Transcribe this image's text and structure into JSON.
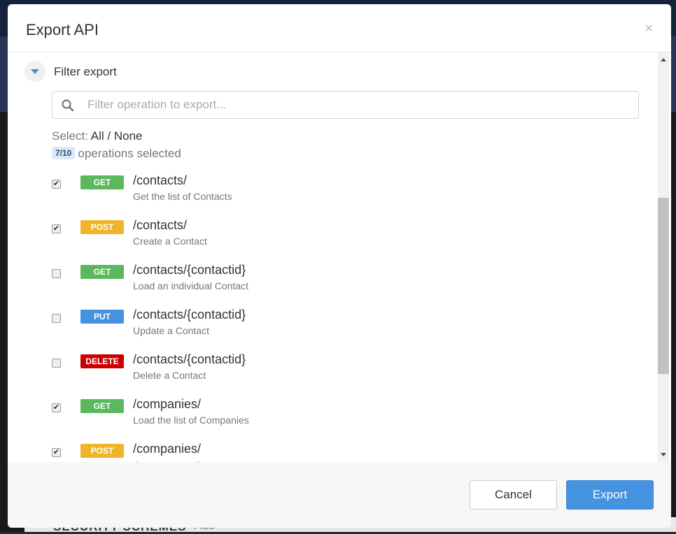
{
  "background": {
    "section_label": "SECURITY SCHEMES",
    "add_label": "+ Add"
  },
  "modal": {
    "title": "Export API",
    "close_icon": "×",
    "filter": {
      "title": "Filter export",
      "placeholder": "Filter operation to export...",
      "select_label": "Select:",
      "all_label": "All",
      "separator": " / ",
      "none_label": "None",
      "count": "7/10",
      "count_suffix": "operations selected"
    },
    "operations": [
      {
        "checked": true,
        "method": "GET",
        "color": "#5cb85c",
        "path": "/contacts/",
        "description": "Get the list of Contacts"
      },
      {
        "checked": true,
        "method": "POST",
        "color": "#f0b429",
        "path": "/contacts/",
        "description": "Create a Contact"
      },
      {
        "checked": false,
        "method": "GET",
        "color": "#5cb85c",
        "path": "/contacts/{contactid}",
        "description": "Load an individual Contact"
      },
      {
        "checked": false,
        "method": "PUT",
        "color": "#4592e0",
        "path": "/contacts/{contactid}",
        "description": "Update a Contact"
      },
      {
        "checked": false,
        "method": "DELETE",
        "color": "#cc0000",
        "path": "/contacts/{contactid}",
        "description": "Delete a Contact"
      },
      {
        "checked": true,
        "method": "GET",
        "color": "#5cb85c",
        "path": "/companies/",
        "description": "Load the list of Companies"
      },
      {
        "checked": true,
        "method": "POST",
        "color": "#f0b429",
        "path": "/companies/",
        "description": "Create a new Company"
      }
    ],
    "footer": {
      "cancel": "Cancel",
      "export": "Export"
    }
  }
}
